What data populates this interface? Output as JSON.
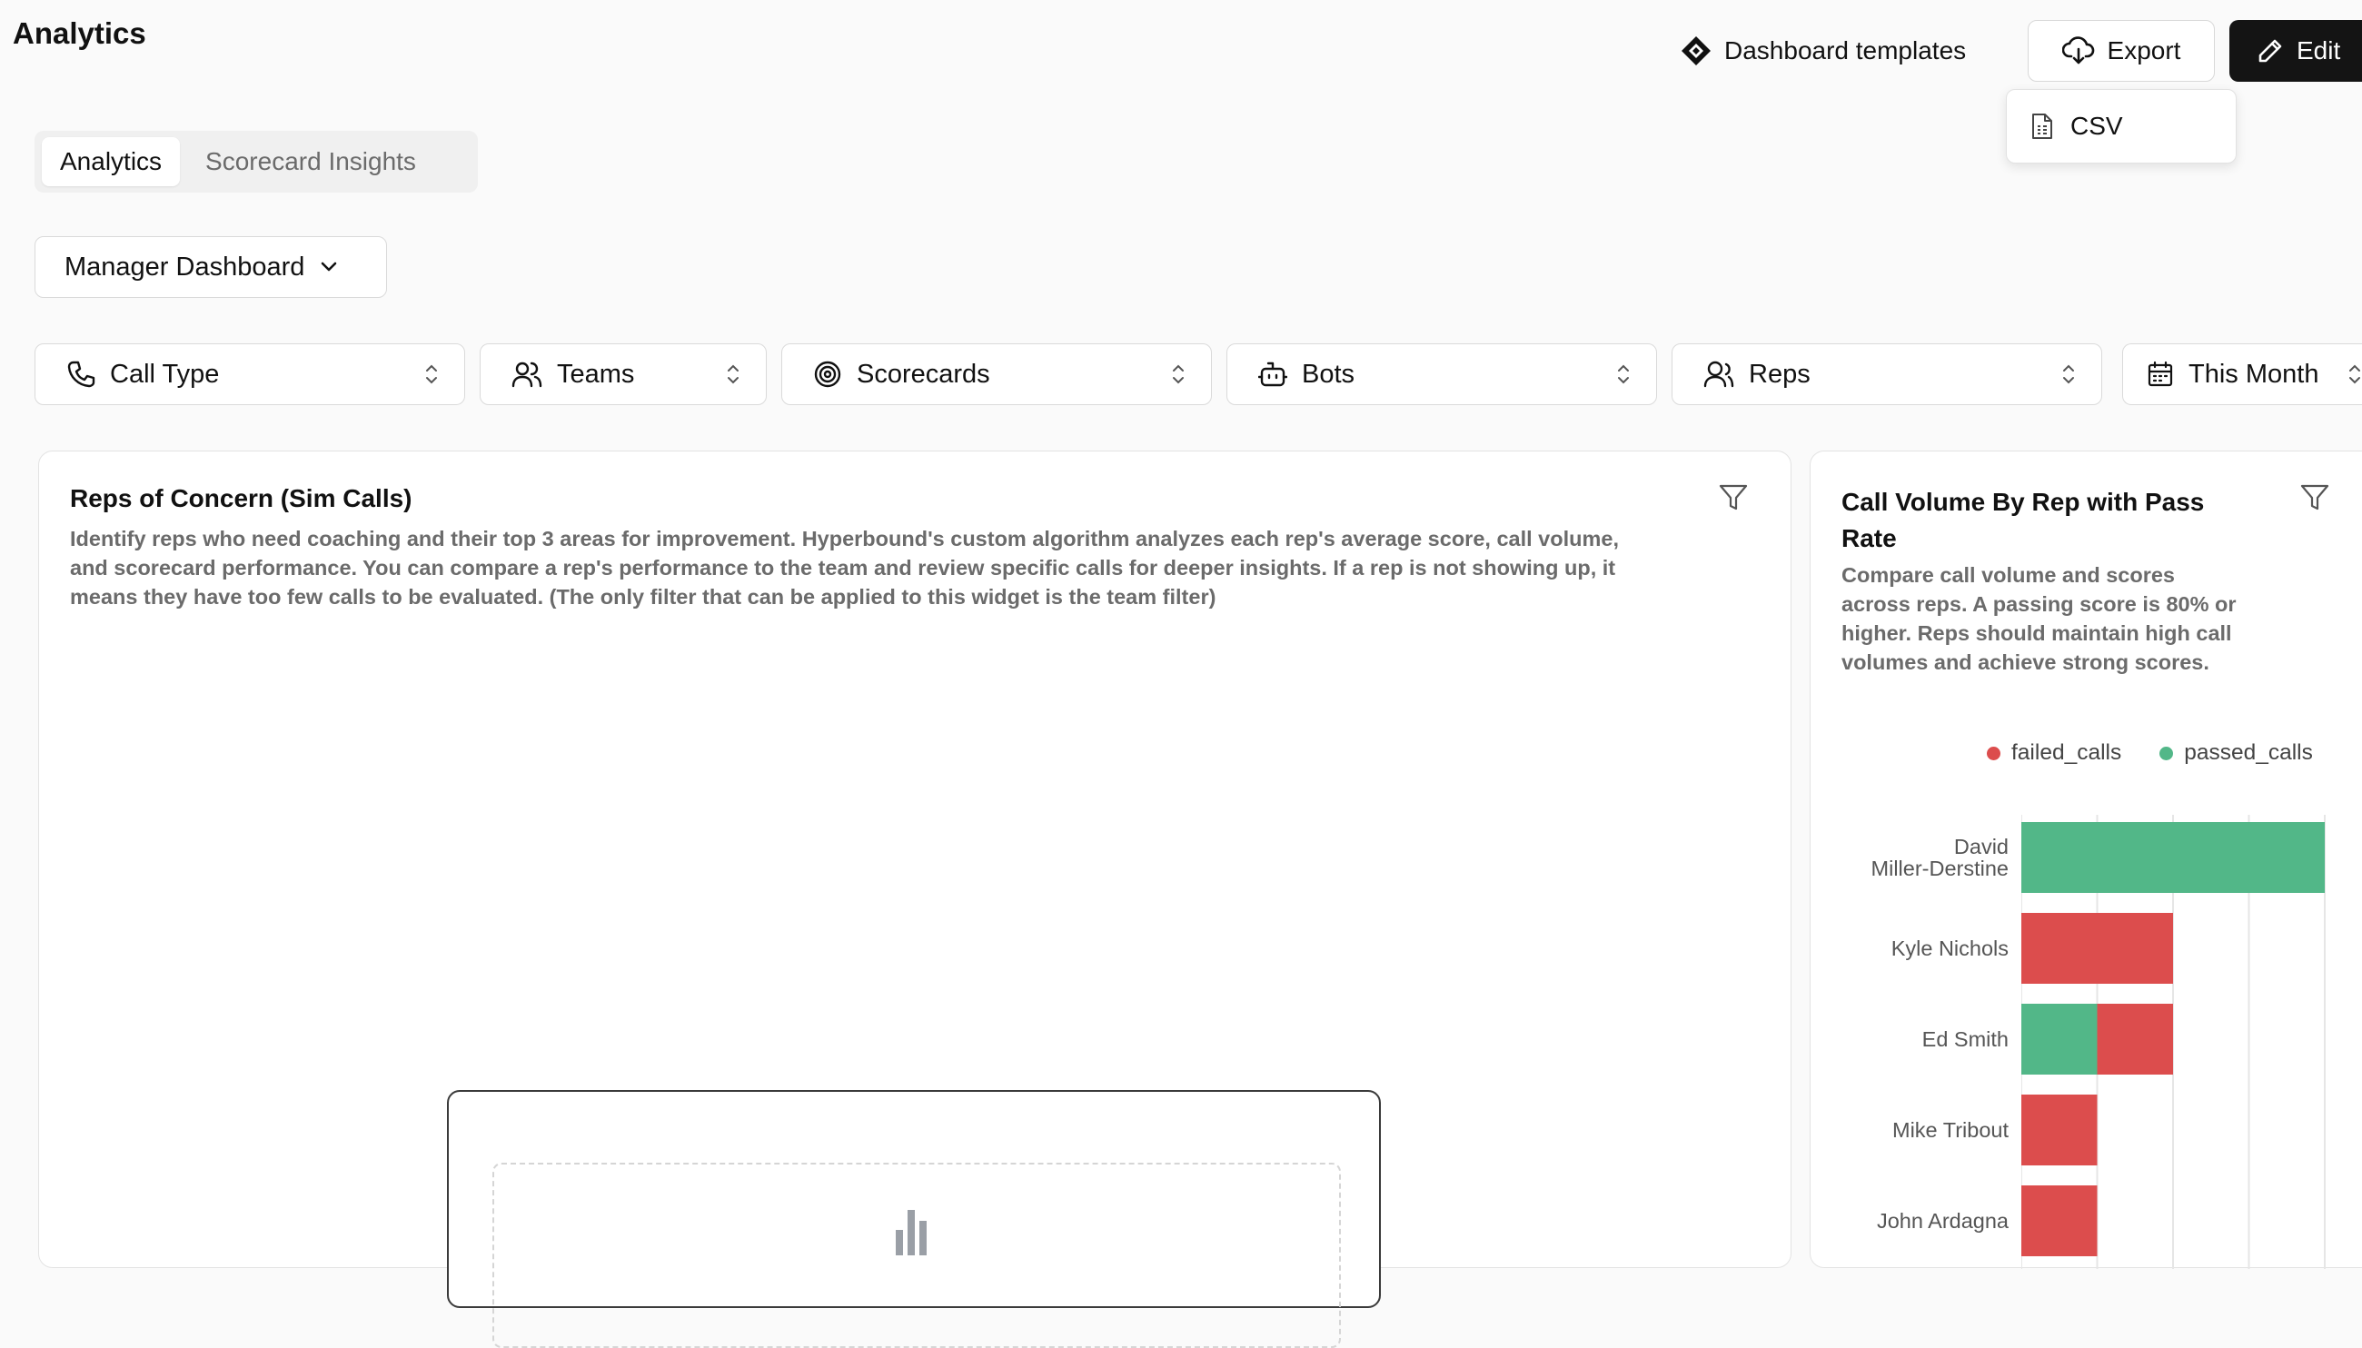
{
  "page": {
    "title": "Analytics"
  },
  "header": {
    "templates_label": "Dashboard templates",
    "export_label": "Export",
    "edit_label": "Edit",
    "export_menu": {
      "items": [
        {
          "label": "CSV",
          "icon": "file-spreadsheet-icon"
        }
      ]
    }
  },
  "tabs": [
    {
      "label": "Analytics",
      "active": true
    },
    {
      "label": "Scorecard Insights",
      "active": false
    }
  ],
  "dashboard_select": {
    "value": "Manager Dashboard"
  },
  "filters": [
    {
      "label": "Call Type",
      "icon": "phone-icon"
    },
    {
      "label": "Teams",
      "icon": "users-icon"
    },
    {
      "label": "Scorecards",
      "icon": "target-icon"
    },
    {
      "label": "Bots",
      "icon": "bot-icon"
    },
    {
      "label": "Reps",
      "icon": "user-group-icon"
    },
    {
      "label": "This Month",
      "icon": "calendar-icon"
    }
  ],
  "widgets": {
    "reps_of_concern": {
      "title": "Reps of Concern (Sim Calls)",
      "description": "Identify reps who need coaching and their top 3 areas for improvement. Hyperbound's custom algorithm analyzes each rep's average score, call volume, and scorecard performance. You can compare a rep's performance to the team and review specific calls for deeper insights. If a rep is not showing up, it means they have too few calls to be evaluated. (The only filter that can be applied to this widget is the team filter)"
    },
    "call_volume": {
      "title": "Call Volume By Rep with Pass Rate",
      "description": "Compare call volume and scores across reps. A passing score is 80% or higher. Reps should maintain high call volumes and achieve strong scores.",
      "legend": [
        {
          "name": "failed_calls",
          "color": "#dc4d4d"
        },
        {
          "name": "passed_calls",
          "color": "#52b788"
        }
      ]
    }
  },
  "chart_data": {
    "type": "bar",
    "orientation": "horizontal",
    "stacked": true,
    "categories": [
      "David Miller-Derstine",
      "Kyle Nichols",
      "Ed Smith",
      "Mike Tribout",
      "John Ardagna"
    ],
    "series": [
      {
        "name": "passed_calls",
        "color": "#52b788",
        "values": [
          4,
          0,
          1,
          0,
          0
        ]
      },
      {
        "name": "failed_calls",
        "color": "#dc4d4d",
        "values": [
          0,
          2,
          1,
          1,
          1
        ]
      }
    ],
    "xlim": [
      0,
      4
    ],
    "grid": true,
    "legend_position": "top"
  }
}
